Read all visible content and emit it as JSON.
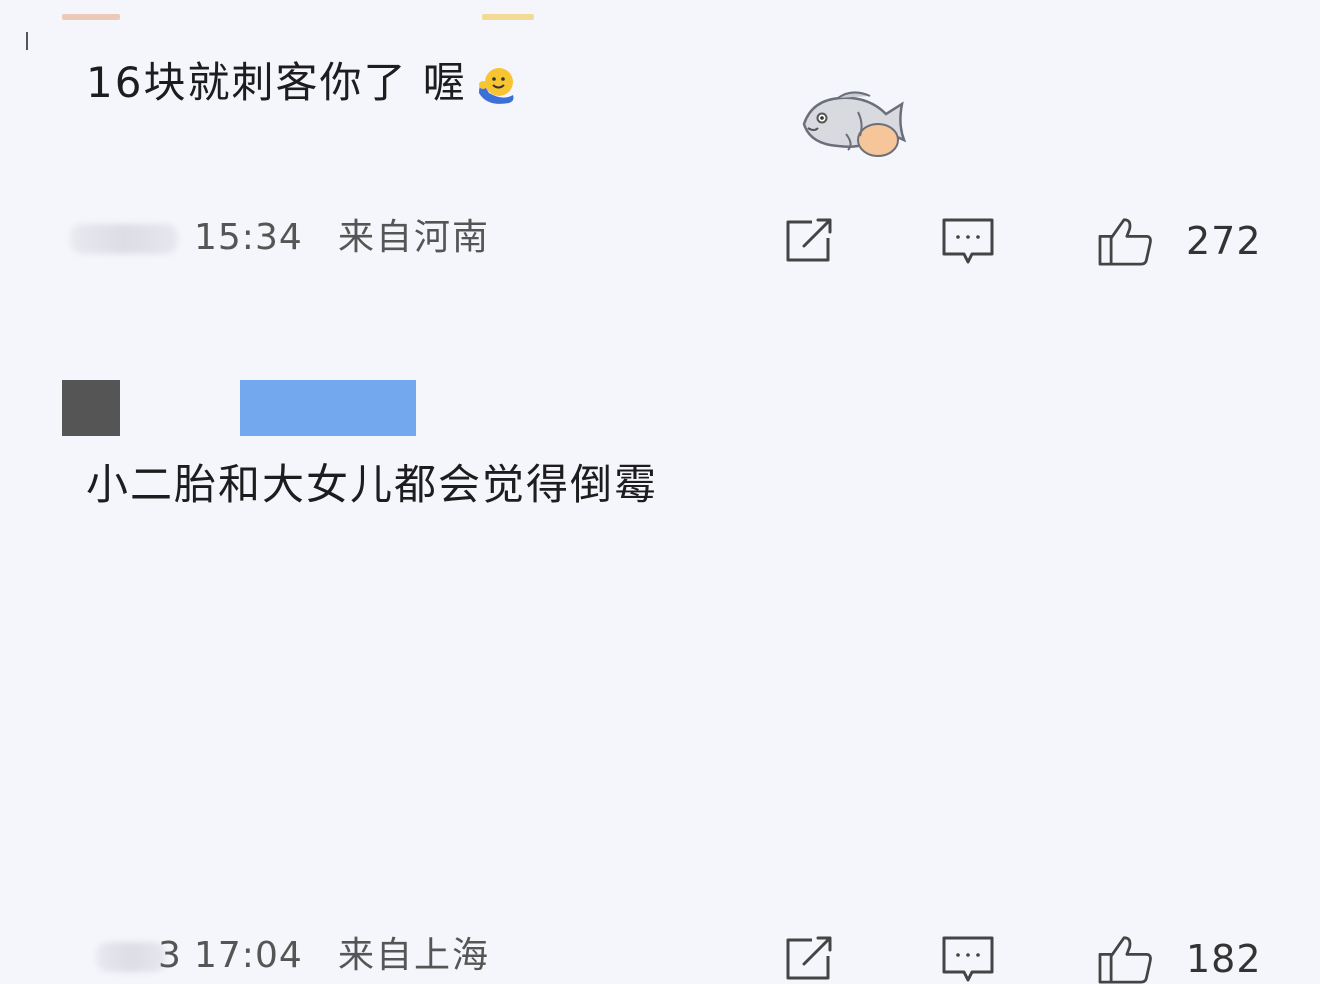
{
  "comments": [
    {
      "text": "16块就刺客你了 喔",
      "time": "15:34",
      "location": "来自河南",
      "likes": "272",
      "emoji_icon": "waving-face-emoji",
      "sticker_icon": "fish-sticker"
    },
    {
      "text": "小二胎和大女儿都会觉得倒霉",
      "partial_prefix": "3",
      "time": "17:04",
      "location": "来自上海",
      "likes": "182"
    }
  ],
  "icons": {
    "share": "share-icon",
    "reply": "reply-icon",
    "like": "thumbs-up-icon"
  },
  "colors": {
    "background": "#f5f6fb",
    "text": "#1d1d1f",
    "meta_text": "#555555",
    "name_bar_blue": "#66a0ec",
    "emoji_yellow": "#f7c531",
    "emoji_blue": "#3d6fd8"
  }
}
